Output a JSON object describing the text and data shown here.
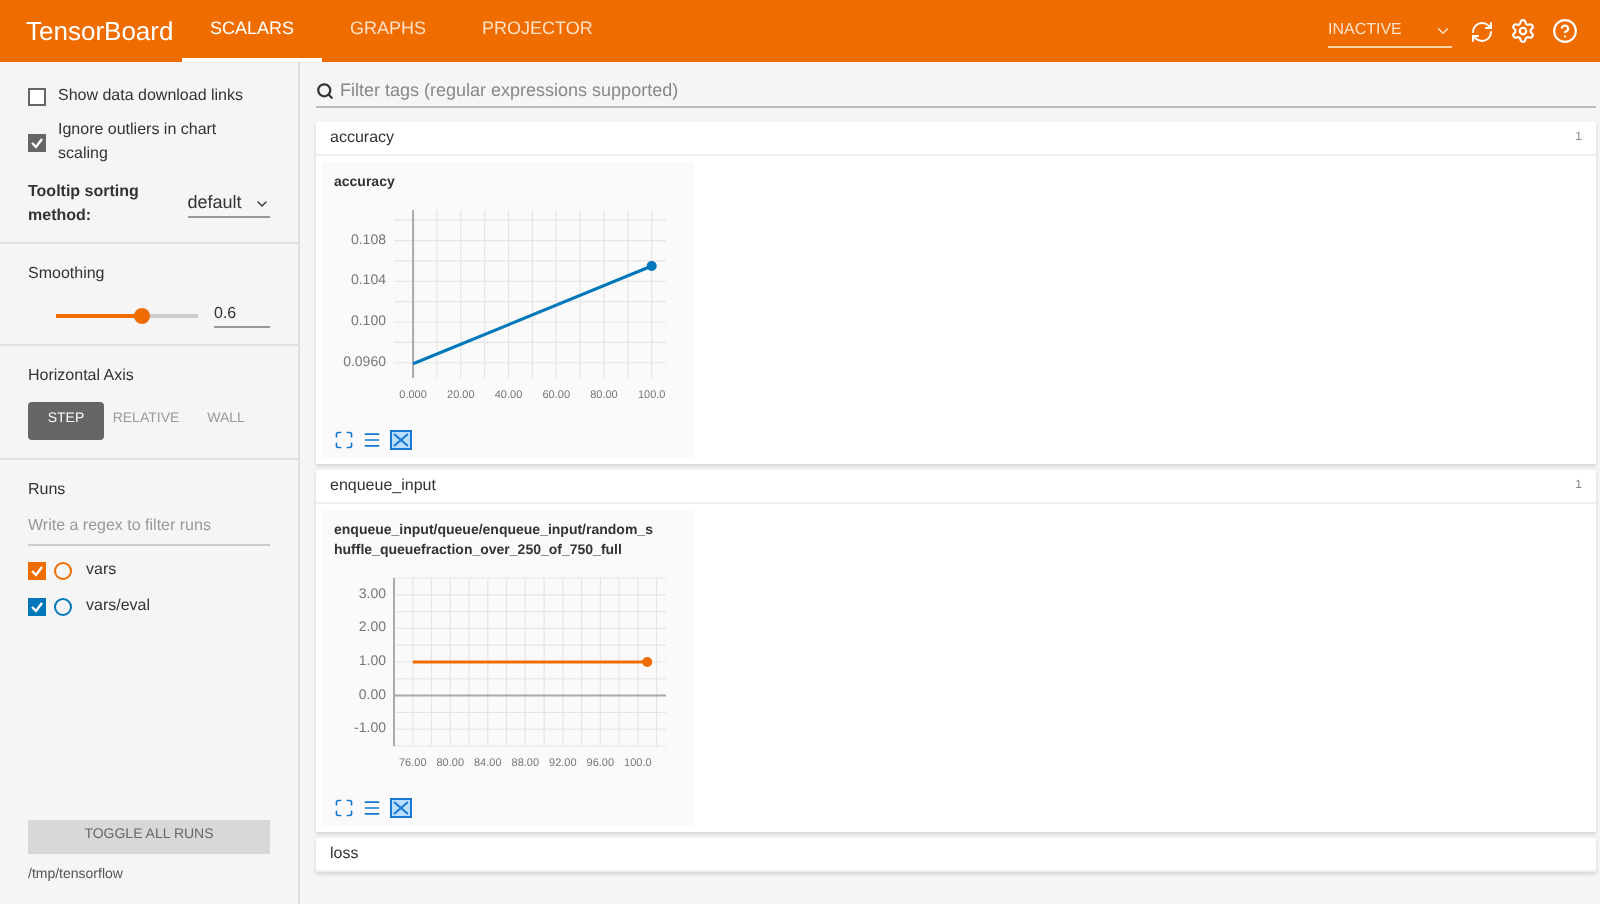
{
  "header": {
    "title": "TensorBoard",
    "tabs": [
      {
        "label": "SCALARS",
        "selected": true
      },
      {
        "label": "GRAPHS",
        "selected": false
      },
      {
        "label": "PROJECTOR",
        "selected": false
      }
    ],
    "run_select": "INACTIVE"
  },
  "sidebar": {
    "options": [
      {
        "label": "Show data download links",
        "checked": false
      },
      {
        "label": "Ignore outliers in chart scaling",
        "checked": true
      }
    ],
    "tooltip_sorting": {
      "label": "Tooltip sorting method:",
      "value": "default"
    },
    "smoothing": {
      "label": "Smoothing",
      "level": 0.6,
      "value": "0.6"
    },
    "horizontal_axis": {
      "label": "Horizontal Axis",
      "options": [
        {
          "label": "STEP",
          "selected": true
        },
        {
          "label": "RELATIVE",
          "selected": false
        },
        {
          "label": "WALL",
          "selected": false
        }
      ]
    },
    "runs": {
      "label": "Runs",
      "placeholder": "Write a regex to filter runs",
      "items": [
        {
          "name": "vars",
          "checked": true,
          "color": "#ef6c00"
        },
        {
          "name": "vars/eval",
          "checked": true,
          "color": "#0077bb"
        }
      ]
    },
    "toggle_button": "TOGGLE ALL RUNS",
    "logdir": "/tmp/tensorflow"
  },
  "search": {
    "placeholder": "Filter tags (regular expressions supported)"
  },
  "sections": [
    {
      "name": "accuracy",
      "count": "1",
      "charts": [
        {
          "title": "accuracy",
          "chart_data": {
            "type": "line",
            "x": [
              0,
              100
            ],
            "grid": true,
            "series": [
              {
                "color": "#0077bb",
                "values": [
                  0.0959,
                  0.1055
                ]
              }
            ],
            "xlim": [
              -8,
              106
            ],
            "ylim": [
              0.0945,
              0.111
            ],
            "xticks": [
              {
                "value": 0,
                "label": "0.000"
              },
              {
                "value": 20,
                "label": "20.00"
              },
              {
                "value": 40,
                "label": "40.00"
              },
              {
                "value": 60,
                "label": "60.00"
              },
              {
                "value": 80,
                "label": "80.00"
              },
              {
                "value": 100,
                "label": "100.0"
              }
            ],
            "yticks": [
              {
                "value": 0.096,
                "label": "0.0960"
              },
              {
                "value": 0.1,
                "label": "0.100"
              },
              {
                "value": 0.104,
                "label": "0.104"
              },
              {
                "value": 0.108,
                "label": "0.108"
              }
            ]
          }
        }
      ]
    },
    {
      "name": "enqueue_input",
      "count": "1",
      "charts": [
        {
          "title": "enqueue_input/queue/enqueue_input/random_shuffle_queuefraction_over_250_of_750_full",
          "chart_data": {
            "type": "line",
            "x": [
              76,
              101
            ],
            "grid": true,
            "series": [
              {
                "color": "#ef6c00",
                "values": [
                  1,
                  1
                ]
              }
            ],
            "xlim": [
              74,
              103
            ],
            "ylim": [
              -1.5,
              3.5
            ],
            "xticks": [
              {
                "value": 76,
                "label": "76.00"
              },
              {
                "value": 80,
                "label": "80.00"
              },
              {
                "value": 84,
                "label": "84.00"
              },
              {
                "value": 88,
                "label": "88.00"
              },
              {
                "value": 92,
                "label": "92.00"
              },
              {
                "value": 96,
                "label": "96.00"
              },
              {
                "value": 100,
                "label": "100.0"
              }
            ],
            "yticks": [
              {
                "value": 3,
                "label": "3.00"
              },
              {
                "value": 2,
                "label": "2.00"
              },
              {
                "value": 1,
                "label": "1.00"
              },
              {
                "value": 0,
                "label": "0.00"
              },
              {
                "value": -1,
                "label": "-1.00"
              }
            ]
          }
        }
      ]
    },
    {
      "name": "loss"
    }
  ]
}
